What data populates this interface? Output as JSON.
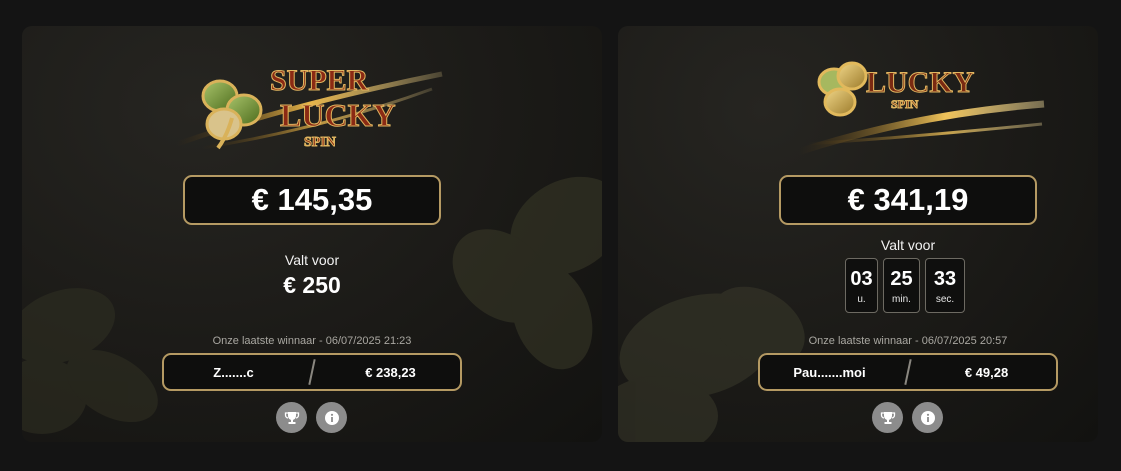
{
  "cards": [
    {
      "logo": {
        "words": [
          "SUPER",
          "LUCKY",
          "SPIN"
        ]
      },
      "jackpot_amount": "€ 145,35",
      "falls_label": "Valt voor",
      "falls_amount": "€ 250",
      "last_winner_label": "Onze laatste winnaar - 06/07/2025 21:23",
      "winner_name": "Z.......c",
      "winner_amount": "€ 238,23",
      "icons": [
        "trophy-icon",
        "info-icon"
      ]
    },
    {
      "logo": {
        "words": [
          "LUCKY",
          "SPIN"
        ]
      },
      "jackpot_amount": "€ 341,19",
      "falls_label": "Valt voor",
      "countdown": [
        {
          "value": "03",
          "unit": "u."
        },
        {
          "value": "25",
          "unit": "min."
        },
        {
          "value": "33",
          "unit": "sec."
        }
      ],
      "last_winner_label": "Onze laatste winnaar - 06/07/2025 20:57",
      "winner_name": "Pau.......moi",
      "winner_amount": "€ 49,28",
      "icons": [
        "trophy-icon",
        "info-icon"
      ]
    }
  ],
  "colors": {
    "background": "#141414",
    "card": "#1b1a17",
    "gold_border": "#b59a63",
    "button": "#8c8c8c"
  }
}
